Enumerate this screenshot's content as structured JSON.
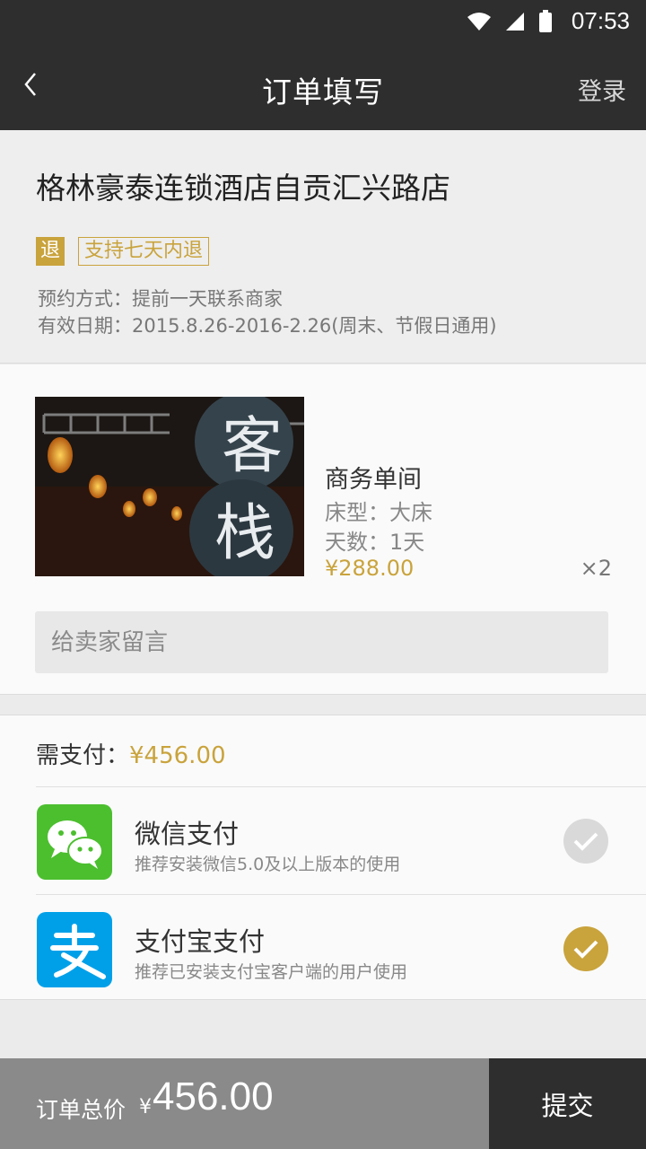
{
  "status_bar": {
    "time": "07:53",
    "icons": [
      "wifi-icon",
      "signal-icon",
      "battery-icon"
    ]
  },
  "navbar": {
    "title": "订单填写",
    "login_label": "登录"
  },
  "hotel": {
    "name": "格林豪泰连锁酒店自贡汇兴路店",
    "refund_badge": "退",
    "refund_tag": "支持七天内退",
    "booking_method": "预约方式：提前一天联系商家",
    "valid_period": "有效日期：2015.8.26-2016-2.26(周末、节假日通用)"
  },
  "product": {
    "image_sign_chars": [
      "客",
      "栈"
    ],
    "room_type": "商务单间",
    "bed_type": "床型：大床",
    "days": "天数：1天",
    "price": "¥288.00",
    "quantity": "×2",
    "message_placeholder": "给卖家留言"
  },
  "payment": {
    "need_label": "需支付：",
    "need_amount": "¥456.00",
    "options": [
      {
        "title": "微信支付",
        "subtitle": "推荐安装微信5.0及以上版本的使用",
        "icon": "wechat-icon",
        "selected": false
      },
      {
        "title": "支付宝支付",
        "subtitle": "推荐已安装支付宝客户端的用户使用",
        "icon": "alipay-icon",
        "selected": true
      }
    ]
  },
  "bottom": {
    "total_label": "订单总价",
    "currency": "¥",
    "total_value": "456.00",
    "submit_label": "提交"
  },
  "colors": {
    "accent_gold": "#c9a33c",
    "bar_dark": "#2e2e2e",
    "wechat_green": "#4cbf2f",
    "alipay_blue": "#00a0e9"
  }
}
